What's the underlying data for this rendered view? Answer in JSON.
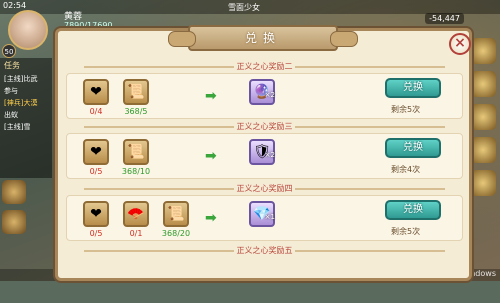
{
  "hud": {
    "clock": "02:54",
    "player_name": "黄蓉",
    "hp": "7890/17690",
    "level": "50",
    "map_name": "雪面少女",
    "score": "-54,447",
    "watermark": "激活 Windows"
  },
  "side_panel": {
    "tab_label": "任务",
    "lines": [
      {
        "text": "[主线]比武",
        "highlight": false
      },
      {
        "text": "参与",
        "highlight": false
      },
      {
        "text": "[神兵]大漠",
        "highlight": true
      },
      {
        "text": "出蚁",
        "highlight": false
      },
      {
        "text": "[主线]雪",
        "highlight": false
      }
    ]
  },
  "dialog": {
    "title": "兑换",
    "close_label": "×",
    "exchange_label": "兑换",
    "rows": [
      {
        "band_title": "正义之心奖励二",
        "costs": [
          {
            "icon": "heart-medal-icon",
            "glyph": "❤",
            "count": "0/4",
            "color": "red"
          },
          {
            "icon": "scroll-icon",
            "glyph": "📜",
            "count": "368/5",
            "color": "green"
          }
        ],
        "reward": {
          "icon": "purple-orb-icon",
          "glyph": "🔮",
          "qty": "×2"
        },
        "remaining": "剩余5次"
      },
      {
        "band_title": "正义之心奖励三",
        "costs": [
          {
            "icon": "heart-medal-icon",
            "glyph": "❤",
            "count": "0/5",
            "color": "red"
          },
          {
            "icon": "scroll-icon",
            "glyph": "📜",
            "count": "368/10",
            "color": "green"
          }
        ],
        "reward": {
          "icon": "armor-icon",
          "glyph": "🛡",
          "qty": "×2"
        },
        "remaining": "剩余4次"
      },
      {
        "band_title": "正义之心奖励四",
        "costs": [
          {
            "icon": "heart-medal-icon",
            "glyph": "❤",
            "count": "0/5",
            "color": "red"
          },
          {
            "icon": "fan-icon",
            "glyph": "🪭",
            "count": "0/1",
            "color": "red"
          },
          {
            "icon": "scroll-icon",
            "glyph": "📜",
            "count": "368/20",
            "color": "green"
          }
        ],
        "reward": {
          "icon": "gem-orb-icon",
          "glyph": "💎",
          "qty": "×1"
        },
        "remaining": "剩余5次"
      },
      {
        "band_title": "正义之心奖励五"
      }
    ]
  }
}
